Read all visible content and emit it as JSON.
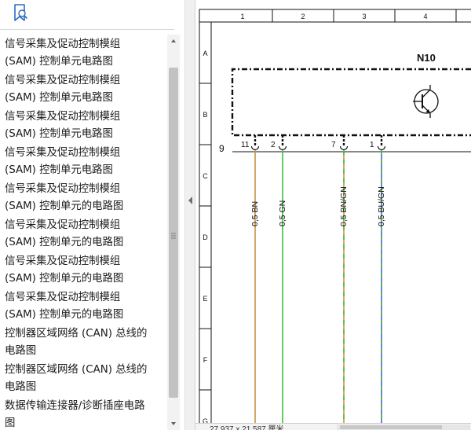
{
  "sidebar": {
    "bookmarks": [
      {
        "line1": "信号采集及促动控制模组",
        "line2": "(SAM) 控制单元电路图"
      },
      {
        "line1": "信号采集及促动控制模组",
        "line2": "(SAM) 控制单元电路图"
      },
      {
        "line1": "信号采集及促动控制模组",
        "line2": "(SAM) 控制单元电路图"
      },
      {
        "line1": "信号采集及促动控制模组",
        "line2": "(SAM) 控制单元电路图"
      },
      {
        "line1": "信号采集及促动控制模组",
        "line2": "(SAM) 控制单元的电路图"
      },
      {
        "line1": "信号采集及促动控制模组",
        "line2": "(SAM) 控制单元的电路图"
      },
      {
        "line1": "信号采集及促动控制模组",
        "line2": "(SAM) 控制单元的电路图"
      },
      {
        "line1": "信号采集及促动控制模组",
        "line2": "(SAM) 控制单元的电路图"
      },
      {
        "line1": "控制器区域网络 (CAN) 总线的",
        "line2": "电路图"
      },
      {
        "line1": "控制器区域网络 (CAN) 总线的",
        "line2": "电路图"
      },
      {
        "line1": "数据传输连接器/诊断插座电路",
        "line2": "图"
      }
    ]
  },
  "drawing": {
    "columns": [
      "1",
      "2",
      "3",
      "4"
    ],
    "rows": [
      "A",
      "B",
      "C",
      "D",
      "E",
      "F",
      "G"
    ],
    "component_label": "N10",
    "connector_label": "9",
    "pins": [
      "11",
      "2",
      "7",
      "1"
    ],
    "wires": [
      {
        "label": "0,5 BN",
        "color": "#c8924a"
      },
      {
        "label": "0,5 GN",
        "color": "#3fbf3f"
      },
      {
        "label": "0,5 BN/GN",
        "color": "#c8924a",
        "stripe": "#3fbf3f"
      },
      {
        "label": "0,5 BU/GN",
        "color": "#5a5adf",
        "stripe": "#3fbf3f"
      }
    ]
  },
  "status": {
    "page_size": "27,937 x 21,587 厘米"
  },
  "colors": {
    "accent": "#2b6cc4",
    "wire_brown": "#c8924a",
    "wire_green": "#3fbf3f",
    "wire_blue": "#5a5adf"
  }
}
